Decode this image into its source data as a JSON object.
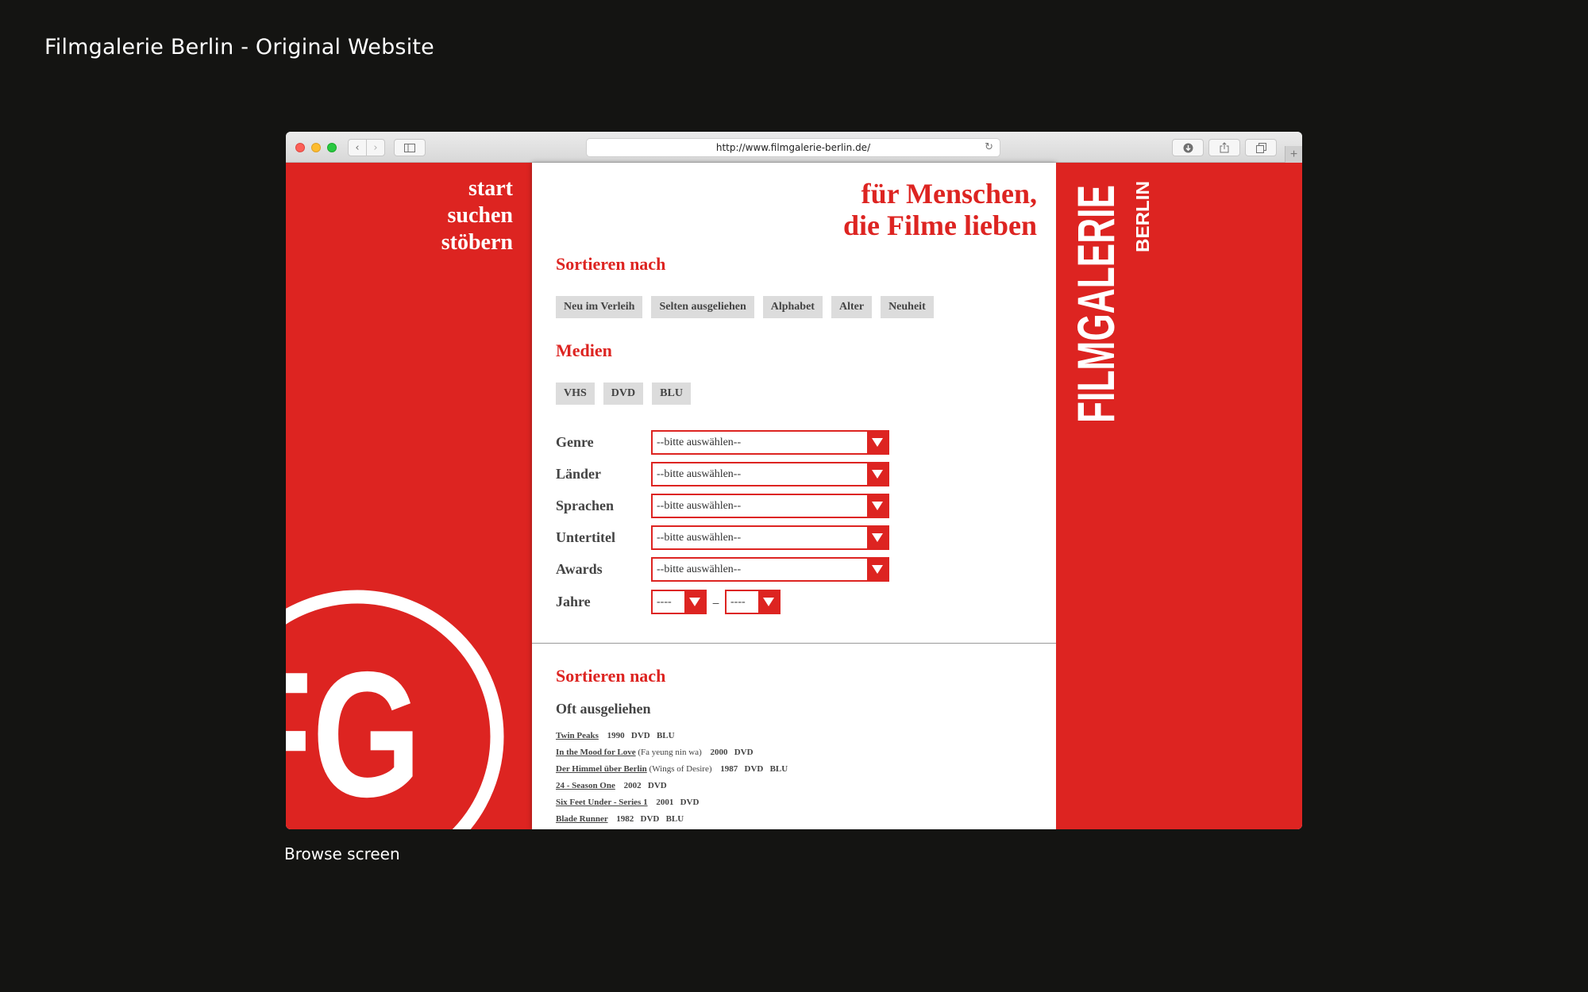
{
  "page": {
    "title": "Filmgalerie Berlin - Original Website",
    "caption": "Browse screen"
  },
  "browser": {
    "url": "http://www.filmgalerie-berlin.de/"
  },
  "nav": [
    "start",
    "suchen",
    "stöbern"
  ],
  "logo": {
    "text": "FG"
  },
  "brand": {
    "name": "FILMGALERIE",
    "city": "BERLIN"
  },
  "tagline": {
    "line1": "für Menschen,",
    "line2": "die Filme lieben"
  },
  "sort": {
    "heading": "Sortieren nach",
    "options": [
      "Neu im Verleih",
      "Selten ausgeliehen",
      "Alphabet",
      "Alter",
      "Neuheit"
    ]
  },
  "media": {
    "heading": "Medien",
    "options": [
      "VHS",
      "DVD",
      "BLU"
    ]
  },
  "filters": [
    {
      "label": "Genre",
      "value": "--bitte auswählen--"
    },
    {
      "label": "Länder",
      "value": "--bitte auswählen--"
    },
    {
      "label": "Sprachen",
      "value": "--bitte auswählen--"
    },
    {
      "label": "Untertitel",
      "value": "--bitte auswählen--"
    },
    {
      "label": "Awards",
      "value": "--bitte auswählen--"
    }
  ],
  "years": {
    "label": "Jahre",
    "from": "----",
    "separator": "–",
    "to": "----"
  },
  "results": {
    "heading": "Sortieren nach",
    "subheading": "Oft ausgeliehen",
    "films": [
      {
        "title": "Twin Peaks",
        "alt": "",
        "meta": "1990   DVD   BLU"
      },
      {
        "title": "In the Mood for Love",
        "alt": "(Fa yeung nin wa)",
        "meta": "2000   DVD"
      },
      {
        "title": "Der Himmel über Berlin",
        "alt": "(Wings of Desire)",
        "meta": "1987   DVD   BLU"
      },
      {
        "title": "24 - Season One",
        "alt": "",
        "meta": "2002   DVD"
      },
      {
        "title": "Six Feet Under - Series 1",
        "alt": "",
        "meta": "2001   DVD"
      },
      {
        "title": "Blade Runner",
        "alt": "",
        "meta": "1982   DVD   BLU"
      }
    ]
  },
  "colors": {
    "brand_red": "#dd2421",
    "chip_grey": "#dcdcdc",
    "background": "#141412"
  }
}
